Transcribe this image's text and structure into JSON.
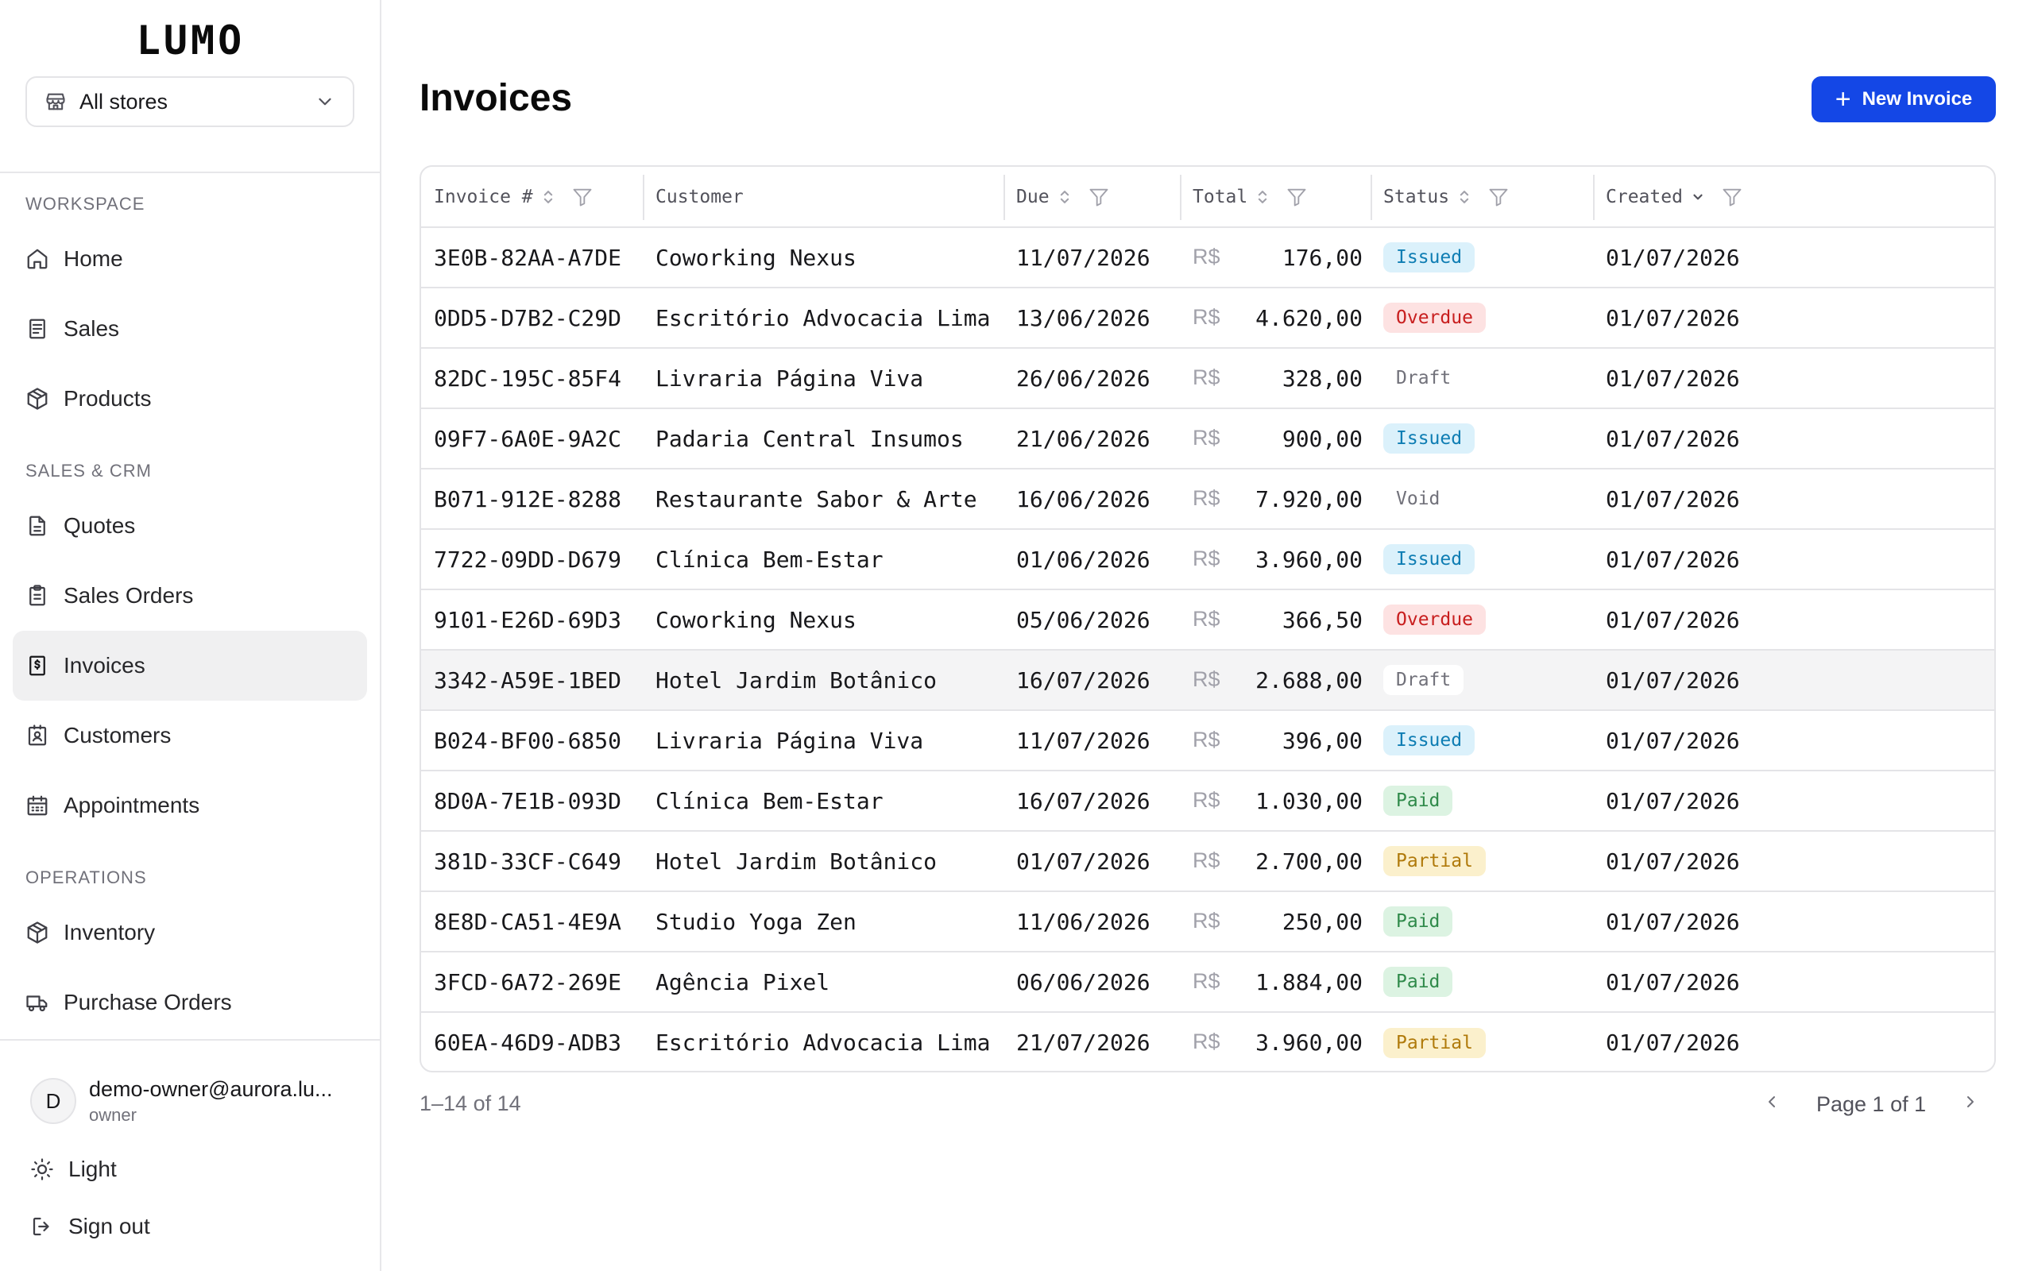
{
  "app": {
    "logo": "LUMO"
  },
  "store_select": {
    "label": "All stores"
  },
  "sidebar": {
    "sections": {
      "workspace": "WORKSPACE",
      "sales_crm": "SALES & CRM",
      "operations": "OPERATIONS"
    },
    "items": [
      {
        "label": "Home",
        "icon": "home-icon"
      },
      {
        "label": "Sales",
        "icon": "receipt-icon"
      },
      {
        "label": "Products",
        "icon": "box-icon"
      },
      {
        "label": "Quotes",
        "icon": "document-icon"
      },
      {
        "label": "Sales Orders",
        "icon": "clipboard-icon"
      },
      {
        "label": "Invoices",
        "icon": "dollar-doc-icon",
        "active": true
      },
      {
        "label": "Customers",
        "icon": "contact-icon"
      },
      {
        "label": "Appointments",
        "icon": "calendar-icon"
      },
      {
        "label": "Inventory",
        "icon": "box-icon"
      },
      {
        "label": "Purchase Orders",
        "icon": "truck-icon"
      }
    ]
  },
  "user": {
    "initial": "D",
    "email": "demo-owner@aurora.lu...",
    "role": "owner"
  },
  "bottom": {
    "theme_label": "Light",
    "signout_label": "Sign out"
  },
  "page": {
    "title": "Invoices",
    "new_button_label": "New Invoice"
  },
  "table": {
    "columns": {
      "invoice": "Invoice #",
      "customer": "Customer",
      "due": "Due",
      "total": "Total",
      "status": "Status",
      "created": "Created"
    },
    "currency": "R$",
    "rows": [
      {
        "id": "3E0B-82AA-A7DE",
        "customer": "Coworking Nexus",
        "due": "11/07/2026",
        "total": "176,00",
        "status": "Issued",
        "created": "01/07/2026"
      },
      {
        "id": "0DD5-D7B2-C29D",
        "customer": "Escritório Advocacia Lima",
        "due": "13/06/2026",
        "total": "4.620,00",
        "status": "Overdue",
        "created": "01/07/2026"
      },
      {
        "id": "82DC-195C-85F4",
        "customer": "Livraria Página Viva",
        "due": "26/06/2026",
        "total": "328,00",
        "status": "Draft",
        "created": "01/07/2026"
      },
      {
        "id": "09F7-6A0E-9A2C",
        "customer": "Padaria Central Insumos",
        "due": "21/06/2026",
        "total": "900,00",
        "status": "Issued",
        "created": "01/07/2026"
      },
      {
        "id": "B071-912E-8288",
        "customer": "Restaurante Sabor & Arte",
        "due": "16/06/2026",
        "total": "7.920,00",
        "status": "Void",
        "created": "01/07/2026"
      },
      {
        "id": "7722-09DD-D679",
        "customer": "Clínica Bem-Estar",
        "due": "01/06/2026",
        "total": "3.960,00",
        "status": "Issued",
        "created": "01/07/2026"
      },
      {
        "id": "9101-E26D-69D3",
        "customer": "Coworking Nexus",
        "due": "05/06/2026",
        "total": "366,50",
        "status": "Overdue",
        "created": "01/07/2026"
      },
      {
        "id": "3342-A59E-1BED",
        "customer": "Hotel Jardim Botânico",
        "due": "16/07/2026",
        "total": "2.688,00",
        "status": "Draft",
        "created": "01/07/2026",
        "highlight": true
      },
      {
        "id": "B024-BF00-6850",
        "customer": "Livraria Página Viva",
        "due": "11/07/2026",
        "total": "396,00",
        "status": "Issued",
        "created": "01/07/2026"
      },
      {
        "id": "8D0A-7E1B-093D",
        "customer": "Clínica Bem-Estar",
        "due": "16/07/2026",
        "total": "1.030,00",
        "status": "Paid",
        "created": "01/07/2026"
      },
      {
        "id": "381D-33CF-C649",
        "customer": "Hotel Jardim Botânico",
        "due": "01/07/2026",
        "total": "2.700,00",
        "status": "Partial",
        "created": "01/07/2026"
      },
      {
        "id": "8E8D-CA51-4E9A",
        "customer": "Studio Yoga Zen",
        "due": "11/06/2026",
        "total": "250,00",
        "status": "Paid",
        "created": "01/07/2026"
      },
      {
        "id": "3FCD-6A72-269E",
        "customer": "Agência Pixel",
        "due": "06/06/2026",
        "total": "1.884,00",
        "status": "Paid",
        "created": "01/07/2026"
      },
      {
        "id": "60EA-46D9-ADB3",
        "customer": "Escritório Advocacia Lima",
        "due": "21/07/2026",
        "total": "3.960,00",
        "status": "Partial",
        "created": "01/07/2026"
      }
    ]
  },
  "footer": {
    "count": "1–14 of 14",
    "page_label": "Page 1 of 1"
  },
  "colors": {
    "accent": "#1447e6",
    "active_nav_bg": "#f0f0f1"
  }
}
